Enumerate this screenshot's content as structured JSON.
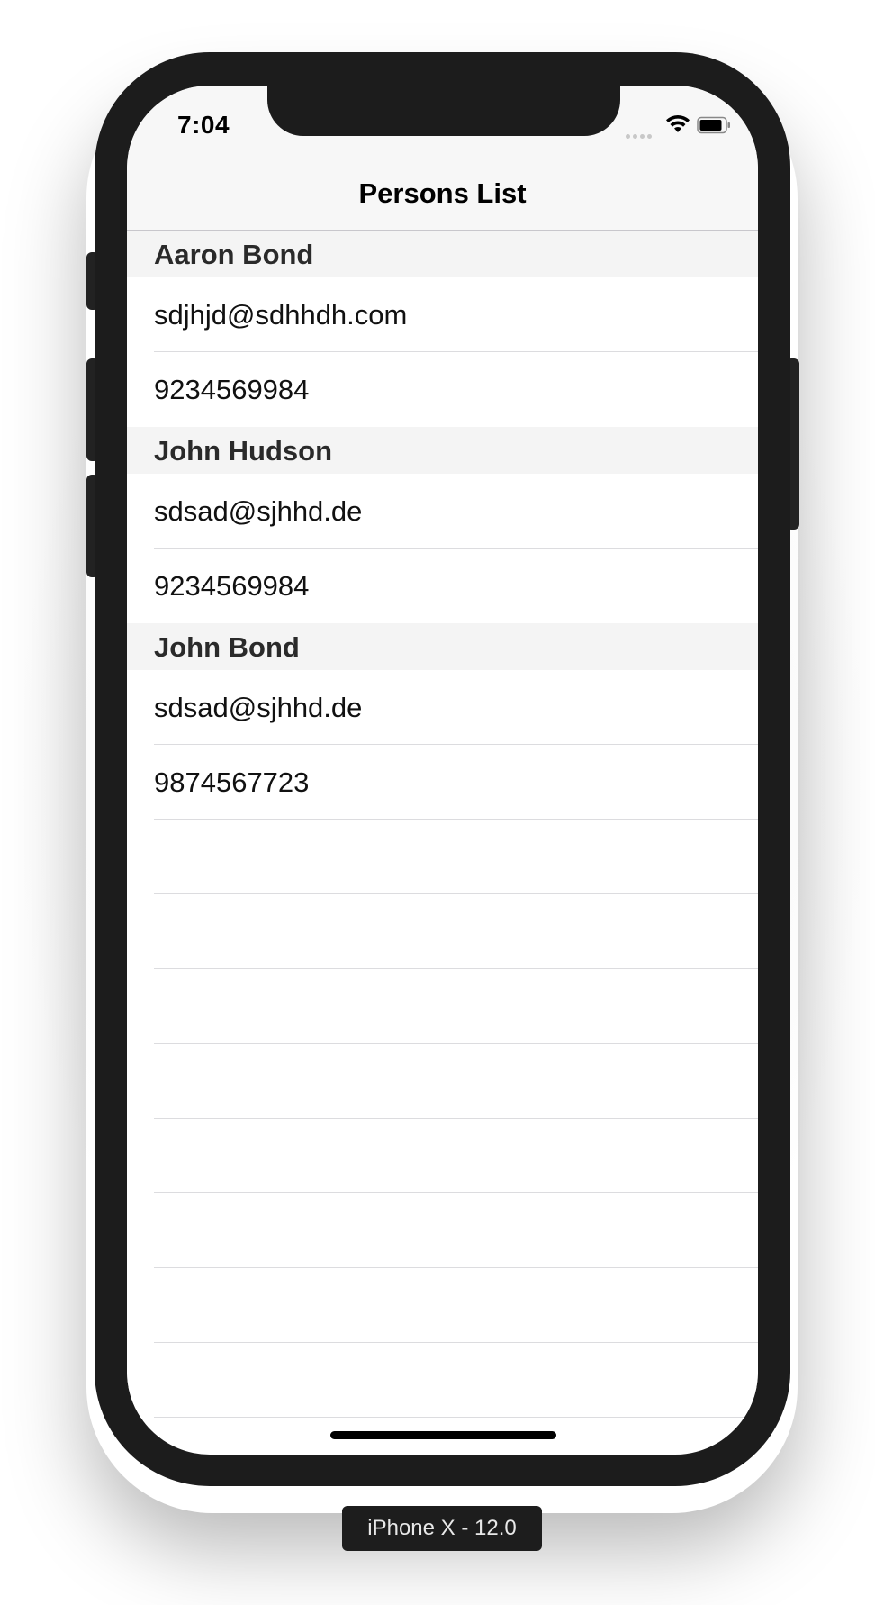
{
  "status_bar": {
    "time": "7:04",
    "icons": [
      "cellular-signal-icon",
      "wifi-icon",
      "battery-icon"
    ]
  },
  "nav": {
    "title": "Persons List"
  },
  "sections": [
    {
      "name": "Aaron Bond",
      "rows": [
        "sdjhjd@sdhhdh.com",
        "9234569984"
      ]
    },
    {
      "name": "John Hudson",
      "rows": [
        "sdsad@sjhhd.de",
        "9234569984"
      ]
    },
    {
      "name": "John Bond",
      "rows": [
        "sdsad@sjhhd.de",
        "9874567723"
      ]
    }
  ],
  "device_label": "iPhone X - 12.0",
  "colors": {
    "navbar_bg": "#f7f7f7",
    "section_header_bg": "#f4f4f4",
    "separator": "#dcdcdf",
    "device_body": "#1c1c1c"
  }
}
